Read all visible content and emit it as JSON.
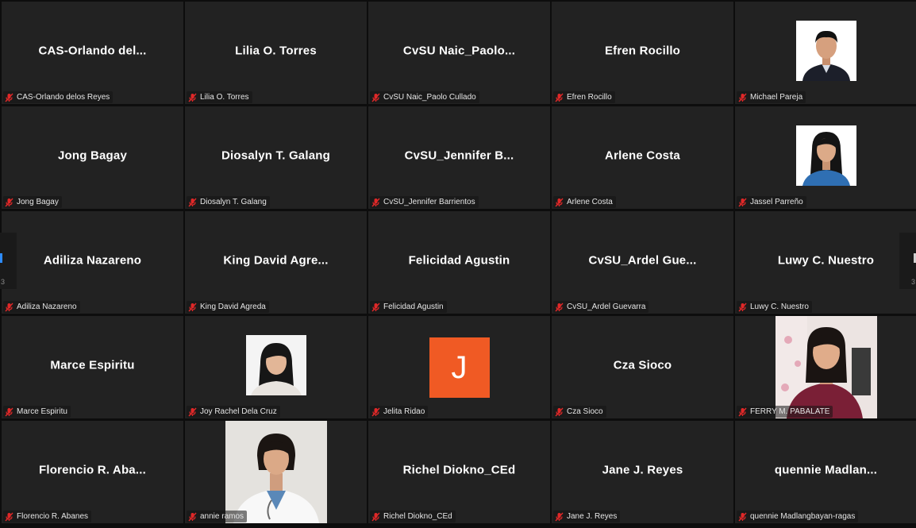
{
  "colors": {
    "tile_bg": "#222222",
    "muted_mic": "#e02828",
    "avatar_orange": "#f05a24",
    "page_indicator": "#2d8cff"
  },
  "pager": {
    "left_page": "3",
    "right_page": "3"
  },
  "participants": [
    {
      "display": "CAS-Orlando  del...",
      "label": "CAS-Orlando delos Reyes",
      "type": "name"
    },
    {
      "display": "Lilia O. Torres",
      "label": "Lilia O. Torres",
      "type": "name"
    },
    {
      "display": "CvSU  Naic_Paolo...",
      "label": "CvSU Naic_Paolo Cullado",
      "type": "name"
    },
    {
      "display": "Efren Rocillo",
      "label": "Efren Rocillo",
      "type": "name"
    },
    {
      "display": "",
      "label": "Michael Pareja",
      "type": "photo-small",
      "variant": "male"
    },
    {
      "display": "Jong Bagay",
      "label": "Jong Bagay",
      "type": "name"
    },
    {
      "display": "Diosalyn T. Galang",
      "label": "Diosalyn T. Galang",
      "type": "name"
    },
    {
      "display": "CvSU_Jennifer  B...",
      "label": "CvSU_Jennifer Barrientos",
      "type": "name"
    },
    {
      "display": "Arlene Costa",
      "label": "Arlene Costa",
      "type": "name"
    },
    {
      "display": "",
      "label": "Jassel Parreño",
      "type": "photo-small",
      "variant": "female"
    },
    {
      "display": "Adiliza Nazareno",
      "label": "Adiliza Nazareno",
      "type": "name"
    },
    {
      "display": "King  David  Agre...",
      "label": "King David Agreda",
      "type": "name"
    },
    {
      "display": "Felicidad Agustin",
      "label": "Felicidad Agustin",
      "type": "name"
    },
    {
      "display": "CvSU_Ardel  Gue...",
      "label": "CvSU_Ardel Guevarra",
      "type": "name"
    },
    {
      "display": "Luwy C. Nuestro",
      "label": "Luwy C. Nuestro",
      "type": "name"
    },
    {
      "display": "Marce Espiritu",
      "label": "Marce Espiritu",
      "type": "name"
    },
    {
      "display": "",
      "label": "Joy Rachel Dela Cruz",
      "type": "photo-small",
      "variant": "female-light"
    },
    {
      "display": "J",
      "label": "Jelita Ridao",
      "type": "avatar"
    },
    {
      "display": "Cza Sioco",
      "label": "Cza Sioco",
      "type": "name"
    },
    {
      "display": "",
      "label": "FERRY M. PABALATE",
      "type": "photo-wide",
      "variant": "room"
    },
    {
      "display": "Florencio  R.  Aba...",
      "label": "Florencio R. Abanes",
      "type": "name"
    },
    {
      "display": "",
      "label": "annie ramos",
      "type": "photo-wide",
      "variant": "doctor"
    },
    {
      "display": "Richel Diokno_CEd",
      "label": "Richel Diokno_CEd",
      "type": "name"
    },
    {
      "display": "Jane J. Reyes",
      "label": "Jane J. Reyes",
      "type": "name"
    },
    {
      "display": "quennie  Madlan...",
      "label": "quennie Madlangbayan-ragas",
      "type": "name"
    }
  ]
}
